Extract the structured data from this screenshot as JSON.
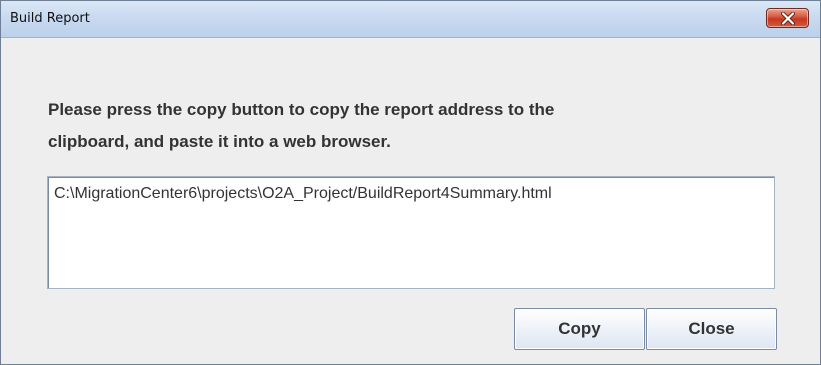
{
  "window": {
    "title": "Build Report"
  },
  "dialog": {
    "message_line1": "Please press the copy button to copy the report address to the",
    "message_line2": "clipboard, and paste it into a web browser.",
    "report_path": "C:\\MigrationCenter6\\projects\\O2A_Project/BuildReport4Summary.html"
  },
  "buttons": {
    "copy_label": "Copy",
    "close_label": "Close"
  },
  "icons": {
    "close": "close-icon"
  },
  "colors": {
    "titlebar": "#c9daf0",
    "close_button": "#d7543b",
    "dialog_background": "#eeeeee",
    "text": "#333333"
  }
}
